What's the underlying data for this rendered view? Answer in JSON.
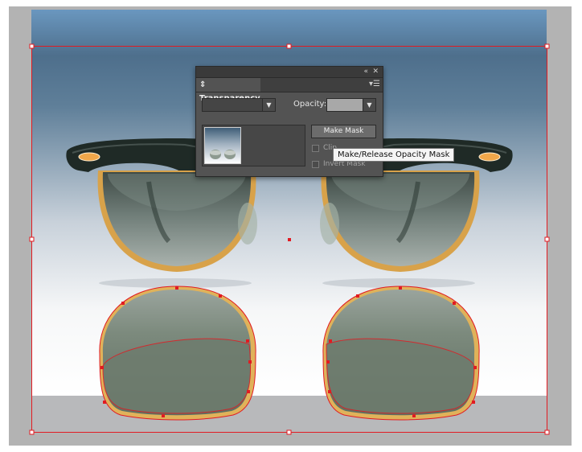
{
  "colors": {
    "workspace": "#b3b3b3",
    "sky_top": "#6996bd",
    "sky_bottom": "#f5f6f7",
    "floor": "#b8b9bb",
    "selection": "#e11b22",
    "lens_tint": "#6c7a6a",
    "frame": "#1f2a26",
    "gold": "#e0b25a"
  },
  "panel": {
    "collapse_icon": "double-chevron-icon",
    "close_icon": "close-icon",
    "tab_label": "Transparency",
    "tab_icon": "expand-collapse-arrows-icon",
    "menu_icon": "panel-menu-icon",
    "blend_mode_value": "",
    "opacity_label": "Opacity:",
    "opacity_value": "",
    "make_mask_label": "Make Mask",
    "clip_label": "Clip",
    "invert_mask_label": "Invert Mask"
  },
  "tooltip": {
    "text": "Make/Release Opacity Mask"
  }
}
